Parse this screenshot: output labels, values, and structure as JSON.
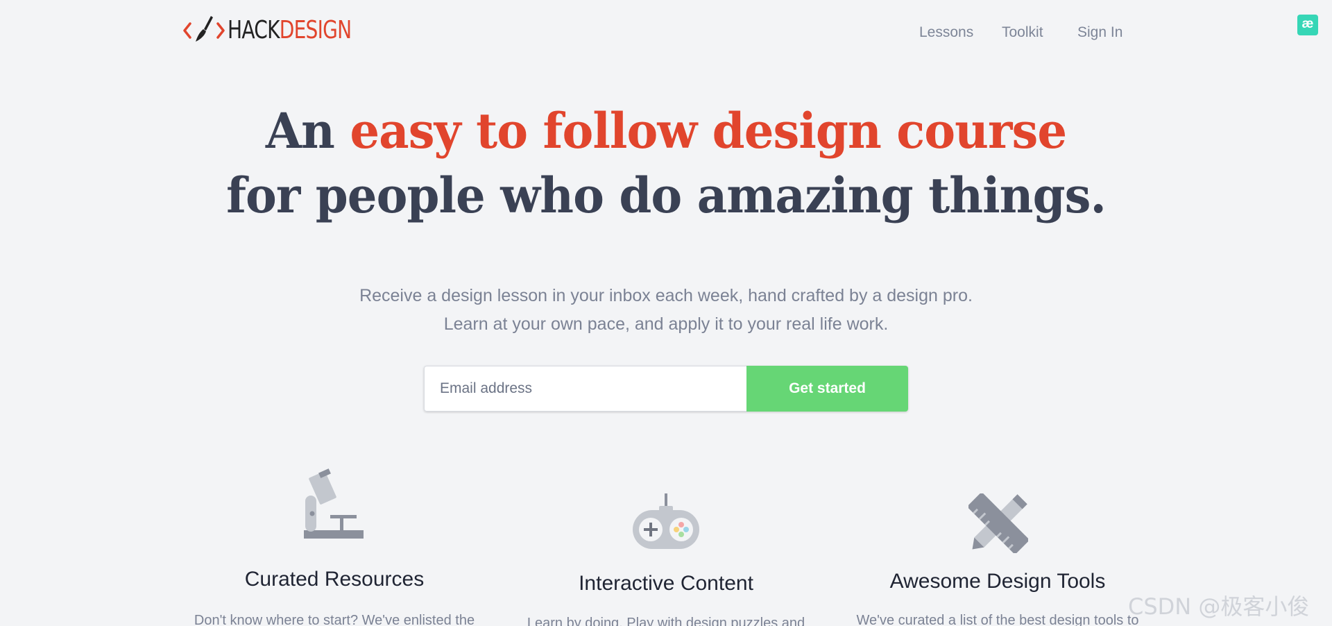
{
  "header": {
    "logo": {
      "hack": "HACK",
      "design": "DESIGN"
    },
    "nav": [
      "Lessons",
      "Toolkit",
      "Sign In"
    ],
    "extension_badge": "æ"
  },
  "hero": {
    "headline_pre": "An ",
    "headline_accent": "easy to follow design course",
    "headline_line2": "for people who do amazing things.",
    "sub_line1": "Receive a design lesson in your inbox each week, hand crafted by a design pro.",
    "sub_line2": "Learn at your own pace, and apply it to your real life work."
  },
  "signup": {
    "email_placeholder": "Email address",
    "email_value": "",
    "button_label": "Get started"
  },
  "features": [
    {
      "icon": "microscope-icon",
      "title": "Curated Resources",
      "text": "Don't know where to start? We've enlisted the"
    },
    {
      "icon": "gamepad-icon",
      "title": "Interactive Content",
      "text": "Learn by doing. Play with design puzzles and"
    },
    {
      "icon": "pencil-ruler-icon",
      "title": "Awesome Design Tools",
      "text": "We've curated a list of the best design tools to"
    }
  ],
  "watermark": "CSDN @极客小俊",
  "colors": {
    "background": "#f3f4f6",
    "accent": "#e1452d",
    "cta": "#66d675",
    "text": "#3a4154",
    "muted": "#7b8294",
    "icon_gray": "#8b909c"
  }
}
